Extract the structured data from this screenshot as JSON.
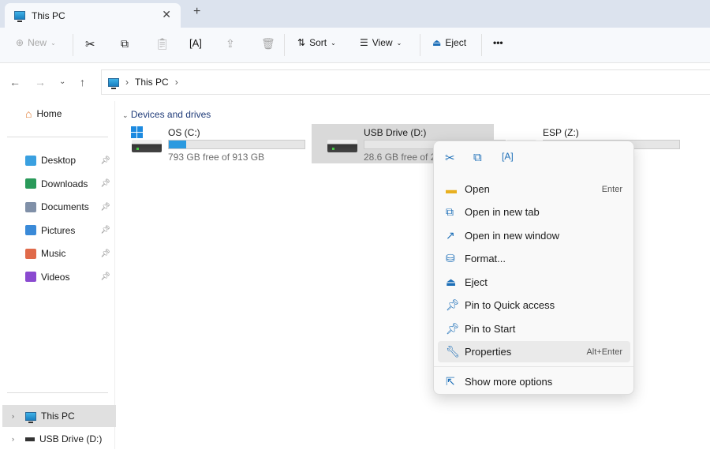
{
  "tab": {
    "title": "This PC"
  },
  "toolbar": {
    "new": "New",
    "sort": "Sort",
    "view": "View",
    "eject": "Eject",
    "more": "•••"
  },
  "address": {
    "path": "This PC"
  },
  "sidebar": {
    "home": "Home",
    "pinned": [
      {
        "label": "Desktop",
        "color": "#3aa0e0"
      },
      {
        "label": "Downloads",
        "color": "#2a9a5a"
      },
      {
        "label": "Documents",
        "color": "#8090a8"
      },
      {
        "label": "Pictures",
        "color": "#3a8ad8"
      },
      {
        "label": "Music",
        "color": "#e06a4a"
      },
      {
        "label": "Videos",
        "color": "#8a4ad0"
      }
    ],
    "tree": [
      "This PC",
      "USB Drive (D:)"
    ]
  },
  "main": {
    "section": "Devices and drives",
    "drives": [
      {
        "name": "OS (C:)",
        "free": "793 GB free of 913 GB",
        "used_fraction": 0.13
      },
      {
        "name": "USB Drive (D:)",
        "free": "28.6 GB free of 28.6 GB",
        "used_fraction": 0.0
      },
      {
        "name": "ESP (Z:)",
        "free": "",
        "used_fraction": 0.0
      }
    ]
  },
  "context_menu": {
    "items": [
      {
        "label": "Open",
        "shortcut": "Enter"
      },
      {
        "label": "Open in new tab"
      },
      {
        "label": "Open in new window"
      },
      {
        "label": "Format..."
      },
      {
        "label": "Eject"
      },
      {
        "label": "Pin to Quick access"
      },
      {
        "label": "Pin to Start"
      },
      {
        "label": "Properties",
        "shortcut": "Alt+Enter"
      },
      {
        "label": "Show more options"
      }
    ]
  }
}
